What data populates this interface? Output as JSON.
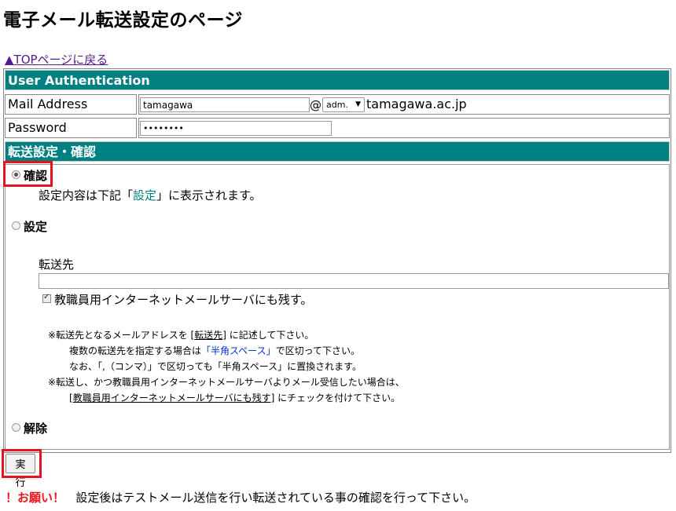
{
  "page": {
    "title": "電子メール転送設定のページ",
    "top_link": "▲TOPページに戻る"
  },
  "auth": {
    "header": "User Authentication",
    "mail_label": "Mail Address",
    "mail_value": "tamagawa",
    "at": "@",
    "domain_select": "adm.",
    "domain_text": "tamagawa.ac.jp",
    "password_label": "Password",
    "password_value": "••••••••"
  },
  "forward": {
    "header": "転送設定・確認",
    "option_confirm": {
      "label": "確認",
      "desc_pre": "設定内容は下記「",
      "desc_link": "設定",
      "desc_post": "」に表示されます。",
      "checked": true
    },
    "option_set": {
      "label": "設定",
      "dest_label": "転送先",
      "dest_value": "",
      "keep_label": "教職員用インターネットメールサーバにも残す。",
      "keep_checked": true,
      "notes": {
        "n1_pre": "※転送先となるメールアドレスを [",
        "n1_link": "転送先",
        "n1_post": "] に記述して下さい。",
        "n2_pre": "複数の転送先を指定する場合は",
        "n2_blue": "「半角スペース」",
        "n2_post": "で区切って下さい。",
        "n3": "なお、「,（コンマ）」で区切っても「半角スペース」に置換されます。",
        "n4": "※転送し、かつ教職員用インターネットメールサーバよりメール受信したい場合は、",
        "n5_pre": "[",
        "n5_link": "教職員用インターネットメールサーバにも残す",
        "n5_post": "] にチェックを付けて下さい。"
      }
    },
    "option_release": {
      "label": "解除"
    }
  },
  "actions": {
    "run_label": "実行"
  },
  "warning": {
    "prefix": "！お願い！",
    "text": "設定後はテストメール送信を行い転送されている事の確認を行って下さい。"
  },
  "colors": {
    "header_bg": "#008080",
    "highlight": "#e8141b",
    "link": "#551a8b"
  }
}
